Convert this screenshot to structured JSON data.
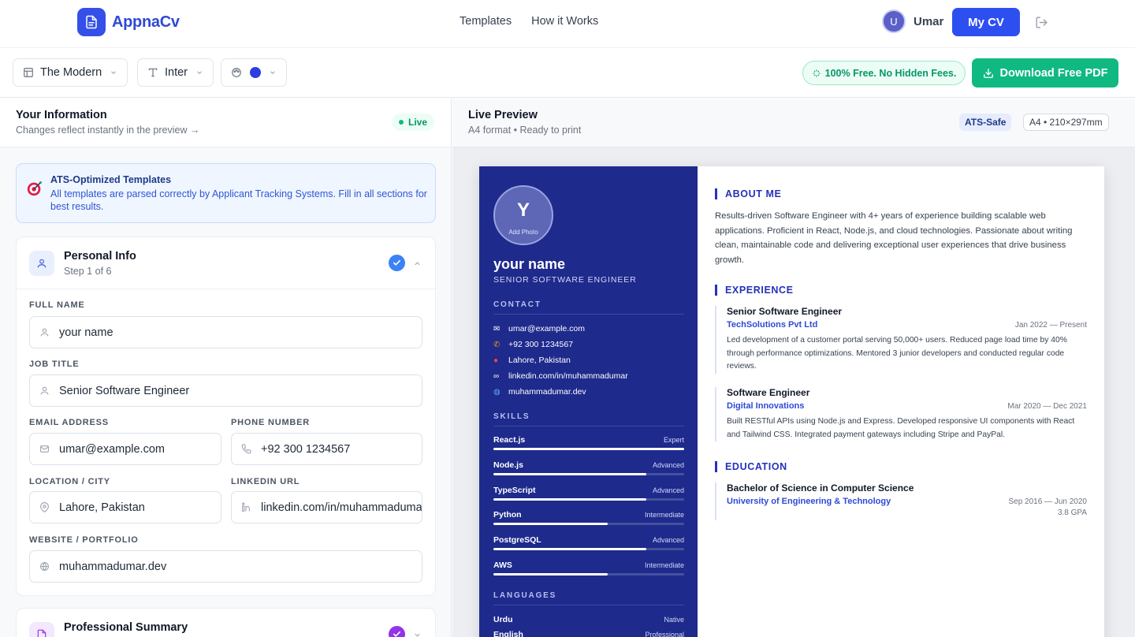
{
  "nav": {
    "logo_text": "AppnaCv",
    "links": [
      "Templates",
      "How it Works"
    ],
    "user_initial": "U",
    "user_name": "Umar",
    "mycv_label": "My CV"
  },
  "toolbar": {
    "template_label": "The Modern",
    "font_label": "Inter",
    "color_swatch": "#2c3ee0",
    "free_badge": "100% Free. No Hidden Fees.",
    "download_label": "Download Free PDF"
  },
  "left": {
    "title": "Your Information",
    "subtitle": "Changes reflect instantly in the preview →",
    "live_label": "Live",
    "ats_title": "ATS-Optimized Templates",
    "ats_desc": "All templates are parsed correctly by Applicant Tracking Systems. Fill in all sections for best results.",
    "personal": {
      "title": "Personal Info",
      "step": "Step 1 of 6",
      "fields": {
        "full_name": {
          "label": "Full Name",
          "value": "your name"
        },
        "job_title": {
          "label": "Job Title",
          "value": "Senior Software Engineer"
        },
        "email": {
          "label": "Email Address",
          "value": "umar@example.com"
        },
        "phone": {
          "label": "Phone Number",
          "value": "+92 300 1234567"
        },
        "location": {
          "label": "Location / City",
          "value": "Lahore, Pakistan"
        },
        "linkedin": {
          "label": "LinkedIn URL",
          "value": "linkedin.com/in/muhammadumar"
        },
        "website": {
          "label": "Website / Portfolio",
          "value": "muhammadumar.dev"
        }
      }
    },
    "summary_title": "Professional Summary"
  },
  "preview": {
    "title": "Live Preview",
    "subtitle": "A4 format • Ready to print",
    "ats_badge": "ATS-Safe",
    "size_badge": "A4 • 210×297mm"
  },
  "resume": {
    "photo_initial": "Y",
    "photo_label": "Add Photo",
    "name": "your name",
    "role": "SENIOR SOFTWARE ENGINEER",
    "contact_heading": "CONTACT",
    "contact": [
      {
        "icon": "envelope-icon",
        "text": "umar@example.com"
      },
      {
        "icon": "phone-icon",
        "text": "+92 300 1234567"
      },
      {
        "icon": "pin-icon",
        "text": "Lahore, Pakistan"
      },
      {
        "icon": "link-icon",
        "text": "linkedin.com/in/muhammadumar"
      },
      {
        "icon": "globe-icon",
        "text": "muhammadumar.dev"
      }
    ],
    "skills_heading": "SKILLS",
    "skills": [
      {
        "name": "React.js",
        "level": "Expert",
        "fill": 1.0
      },
      {
        "name": "Node.js",
        "level": "Advanced",
        "fill": 0.8
      },
      {
        "name": "TypeScript",
        "level": "Advanced",
        "fill": 0.8
      },
      {
        "name": "Python",
        "level": "Intermediate",
        "fill": 0.6
      },
      {
        "name": "PostgreSQL",
        "level": "Advanced",
        "fill": 0.8
      },
      {
        "name": "AWS",
        "level": "Intermediate",
        "fill": 0.6
      }
    ],
    "languages_heading": "LANGUAGES",
    "languages": [
      {
        "name": "Urdu",
        "level": "Native"
      },
      {
        "name": "English",
        "level": "Professional"
      }
    ],
    "about_heading": "ABOUT ME",
    "about": "Results-driven Software Engineer with 4+ years of experience building scalable web applications. Proficient in React, Node.js, and cloud technologies. Passionate about writing clean, maintainable code and delivering exceptional user experiences that drive business growth.",
    "experience_heading": "EXPERIENCE",
    "experience": [
      {
        "title": "Senior Software Engineer",
        "company": "TechSolutions Pvt Ltd",
        "dates": "Jan 2022 — Present",
        "desc": "Led development of a customer portal serving 50,000+ users. Reduced page load time by 40% through performance optimizations. Mentored 3 junior developers and conducted regular code reviews."
      },
      {
        "title": "Software Engineer",
        "company": "Digital Innovations",
        "dates": "Mar 2020 — Dec 2021",
        "desc": "Built RESTful APIs using Node.js and Express. Developed responsive UI components with React and Tailwind CSS. Integrated payment gateways including Stripe and PayPal."
      }
    ],
    "education_heading": "EDUCATION",
    "education": {
      "degree": "Bachelor of Science in Computer Science",
      "school": "University of Engineering & Technology",
      "dates": "Sep 2016 — Jun 2020",
      "gpa": "3.8 GPA"
    }
  }
}
